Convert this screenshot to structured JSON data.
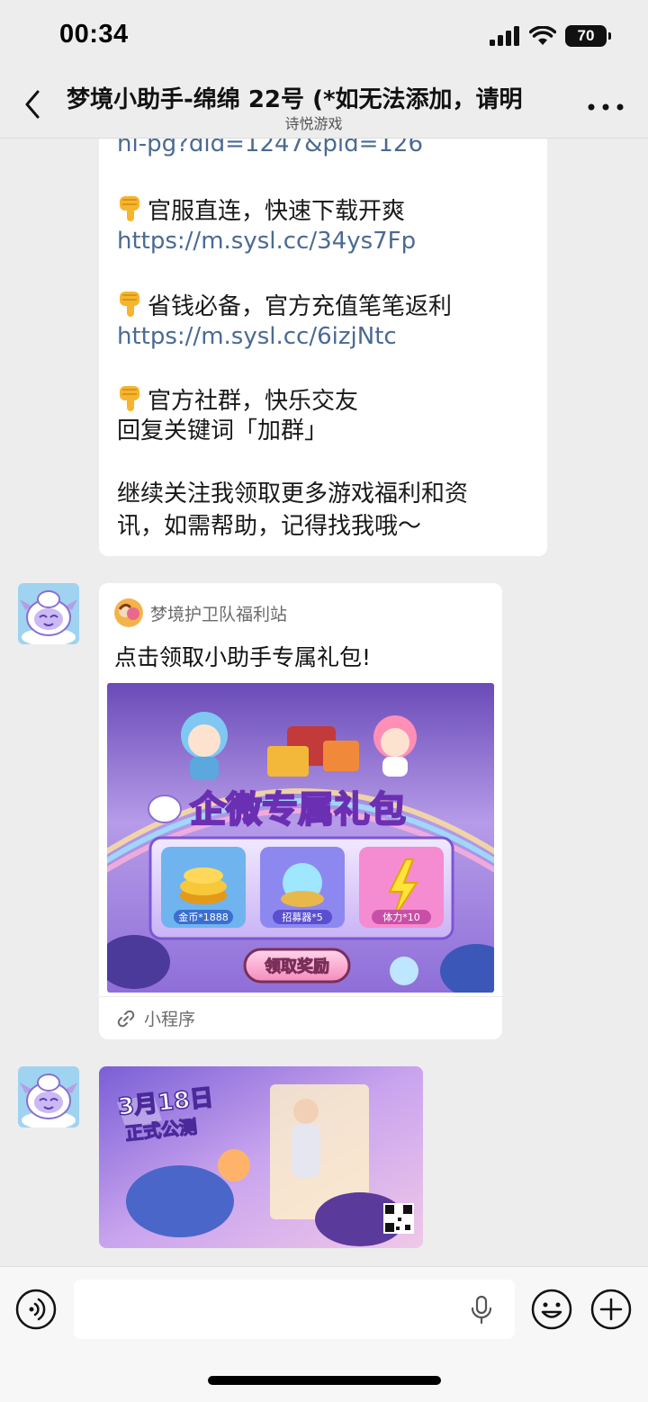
{
  "status": {
    "time": "00:34",
    "battery": "70"
  },
  "nav": {
    "title": "梦境小助手-绵绵 22号 (*如无法添加，请明",
    "subtitle": "诗悦游戏"
  },
  "message1": {
    "lines": [
      "hi-pg?did=1247&pid=126",
      "官服直连，快速下载开爽",
      "https://m.sysl.cc/34ys7Fp",
      "省钱必备，官方充值笔笔返利",
      "https://m.sysl.cc/6izjNtc",
      "官方社群，快乐交友",
      "回复关键词「加群」",
      "继续关注我领取更多游戏福利和资",
      "讯，如需帮助，记得找我哦～"
    ]
  },
  "card": {
    "source": "梦境护卫队福利站",
    "title": "点击领取小助手专属礼包!",
    "banner_title": "企微专属礼包",
    "items": [
      "金币*1888",
      "招募器*5",
      "体力*10"
    ],
    "claim_button": "领取奖励",
    "footer": "小程序"
  },
  "poster": {
    "date_text": "3月18日",
    "headline": "正式公测"
  },
  "colors": {
    "background": "#ededed",
    "link": "#4a6a94",
    "bubble": "#ffffff"
  },
  "icons": [
    "back-chevron-icon",
    "more-icon",
    "pointing-hand-icon",
    "link-icon",
    "voice-icon",
    "mic-icon",
    "emoji-icon",
    "plus-icon"
  ]
}
